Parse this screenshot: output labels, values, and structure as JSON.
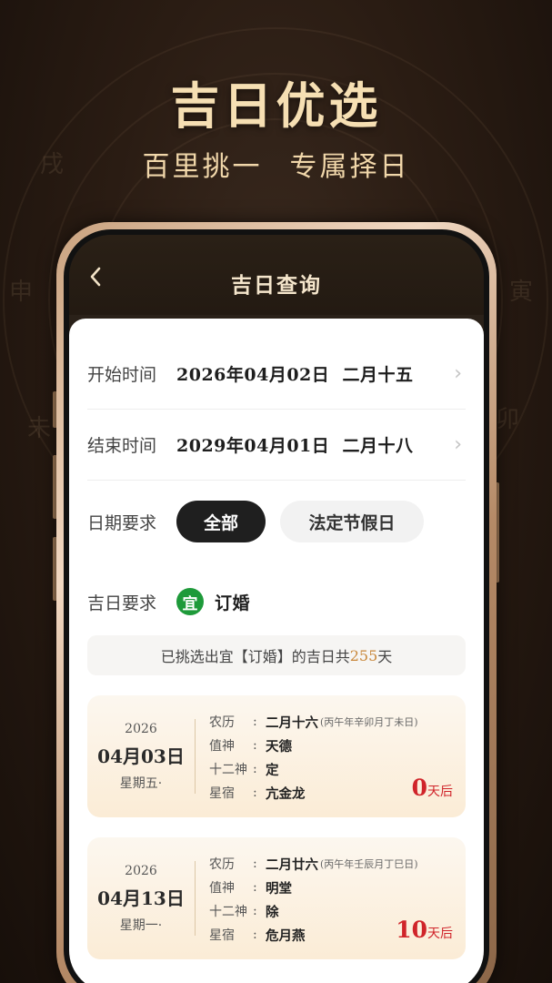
{
  "hero": {
    "title": "吉日优选",
    "subtitle_left": "百里挑一",
    "subtitle_right": "专属择日"
  },
  "nav": {
    "back_icon": "chevron-left-icon",
    "title": "吉日查询"
  },
  "form": {
    "start": {
      "label": "开始时间",
      "value": "2026年04月02日  二月十五"
    },
    "end": {
      "label": "结束时间",
      "value": "2029年04月01日  二月十八"
    },
    "date_req": {
      "label": "日期要求",
      "options": [
        "全部",
        "法定节假日"
      ],
      "selected": "全部"
    },
    "lucky_req": {
      "label": "吉日要求",
      "badge": "宜",
      "value": "订婚"
    }
  },
  "summary": {
    "prefix": "已挑选出宜【订婚】的吉日共",
    "count": "255",
    "suffix": "天"
  },
  "days": [
    {
      "year": "2026",
      "month_day": "04月03日",
      "weekday": "星期五·",
      "lunar_label": "农历",
      "lunar": "二月十六",
      "lunar_note": "(丙午年辛卯月丁未日)",
      "zhishen_label": "值神",
      "zhishen": "天德",
      "shier_label": "十二神",
      "shier": "定",
      "xingsu_label": "星宿",
      "xingsu": "亢金龙",
      "days_num": "0",
      "days_unit": "天后"
    },
    {
      "year": "2026",
      "month_day": "04月13日",
      "weekday": "星期一·",
      "lunar_label": "农历",
      "lunar": "二月廿六",
      "lunar_note": "(丙午年壬辰月丁巳日)",
      "zhishen_label": "值神",
      "zhishen": "明堂",
      "shier_label": "十二神",
      "shier": "除",
      "xingsu_label": "星宿",
      "xingsu": "危月燕",
      "days_num": "10",
      "days_unit": "天后"
    }
  ],
  "colors": {
    "accent_gold": "#f6dfb3",
    "yi_green": "#1e9a3a",
    "count_orange": "#c8873a",
    "days_red": "#d0242a"
  }
}
